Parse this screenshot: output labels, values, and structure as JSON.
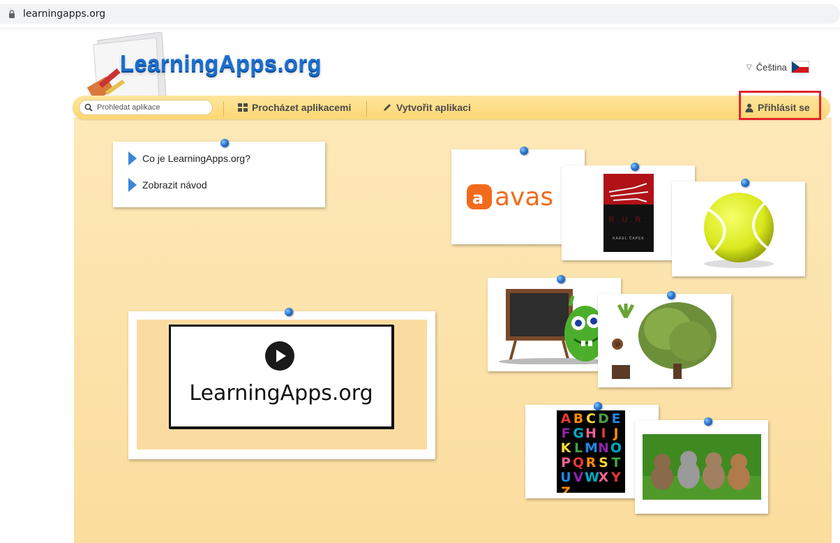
{
  "browser": {
    "url": "learningapps.org",
    "lock_icon": "lock-icon"
  },
  "header": {
    "logo_text": "LearningApps.org",
    "language": "Čeština"
  },
  "navbar": {
    "search_placeholder": "Prohledat aplikace",
    "browse_label": "Procházet aplikacemi",
    "create_label": "Vytvořit aplikaci",
    "login_label": "Přihlásit se"
  },
  "intro_card": {
    "links": [
      "Co je LearningApps.org?",
      "Zobrazit návod"
    ]
  },
  "video_card": {
    "caption": "LearningApps.org"
  },
  "tiles": {
    "avast_text": "avas",
    "rur_title": "R.U.R.",
    "rur_author": "KAREL ČAPEK",
    "alphabet_letters": [
      "A",
      "B",
      "C",
      "D",
      "E",
      "F",
      "G",
      "H",
      "I",
      "J",
      "K",
      "L",
      "M",
      "N",
      "O",
      "P",
      "Q",
      "R",
      "S",
      "T",
      "U",
      "V",
      "W",
      "X",
      "Y",
      "Z"
    ]
  },
  "colors": {
    "accent_blue": "#1a6fcf",
    "navbar": "#fcd774",
    "highlight_red": "#e3242b"
  }
}
